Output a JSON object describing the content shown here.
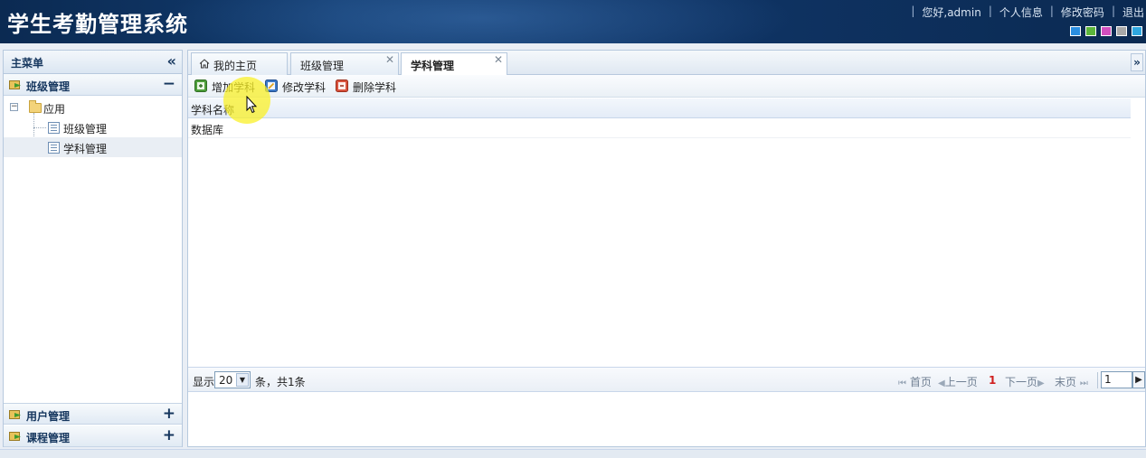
{
  "header": {
    "title": "学生考勤管理系统",
    "links": [
      "您好,admin",
      "个人信息",
      "修改密码",
      "退出"
    ],
    "theme_swatches": [
      "#2a8ee0",
      "#5cb53b",
      "#d24fbf",
      "#a8a8a8",
      "#2fa7e0"
    ]
  },
  "sidebar": {
    "title": "主菜单",
    "collapse_icon": "double-chevron-left-icon",
    "sections": [
      {
        "label": "班级管理",
        "toggle": "−",
        "expanded": true
      },
      {
        "label": "用户管理",
        "toggle": "+",
        "expanded": false
      },
      {
        "label": "课程管理",
        "toggle": "+",
        "expanded": false
      }
    ],
    "tree": {
      "root": "应用",
      "children": [
        "班级管理",
        "学科管理"
      ],
      "selected": "学科管理"
    }
  },
  "tabs": [
    {
      "label": "我的主页",
      "icon": "home-icon",
      "closable": false
    },
    {
      "label": "班级管理",
      "closable": true
    },
    {
      "label": "学科管理",
      "closable": true,
      "active": true
    }
  ],
  "toolbar": {
    "add_label": "增加学科",
    "edit_label": "修改学科",
    "delete_label": "删除学科"
  },
  "grid": {
    "columns": [
      "学科名称"
    ],
    "rows": [
      [
        "数据库"
      ]
    ]
  },
  "pager": {
    "show_label": "显示",
    "page_size": "20",
    "summary": "条，共1条",
    "first_label": "首页",
    "prev_label": "上一页",
    "current_page": "1",
    "next_label": "下一页",
    "last_label": "末页",
    "goto_value": "1"
  },
  "colors": {
    "header_bg": "#0f3465",
    "accent": "#15365e",
    "current_page": "#d0201f"
  }
}
